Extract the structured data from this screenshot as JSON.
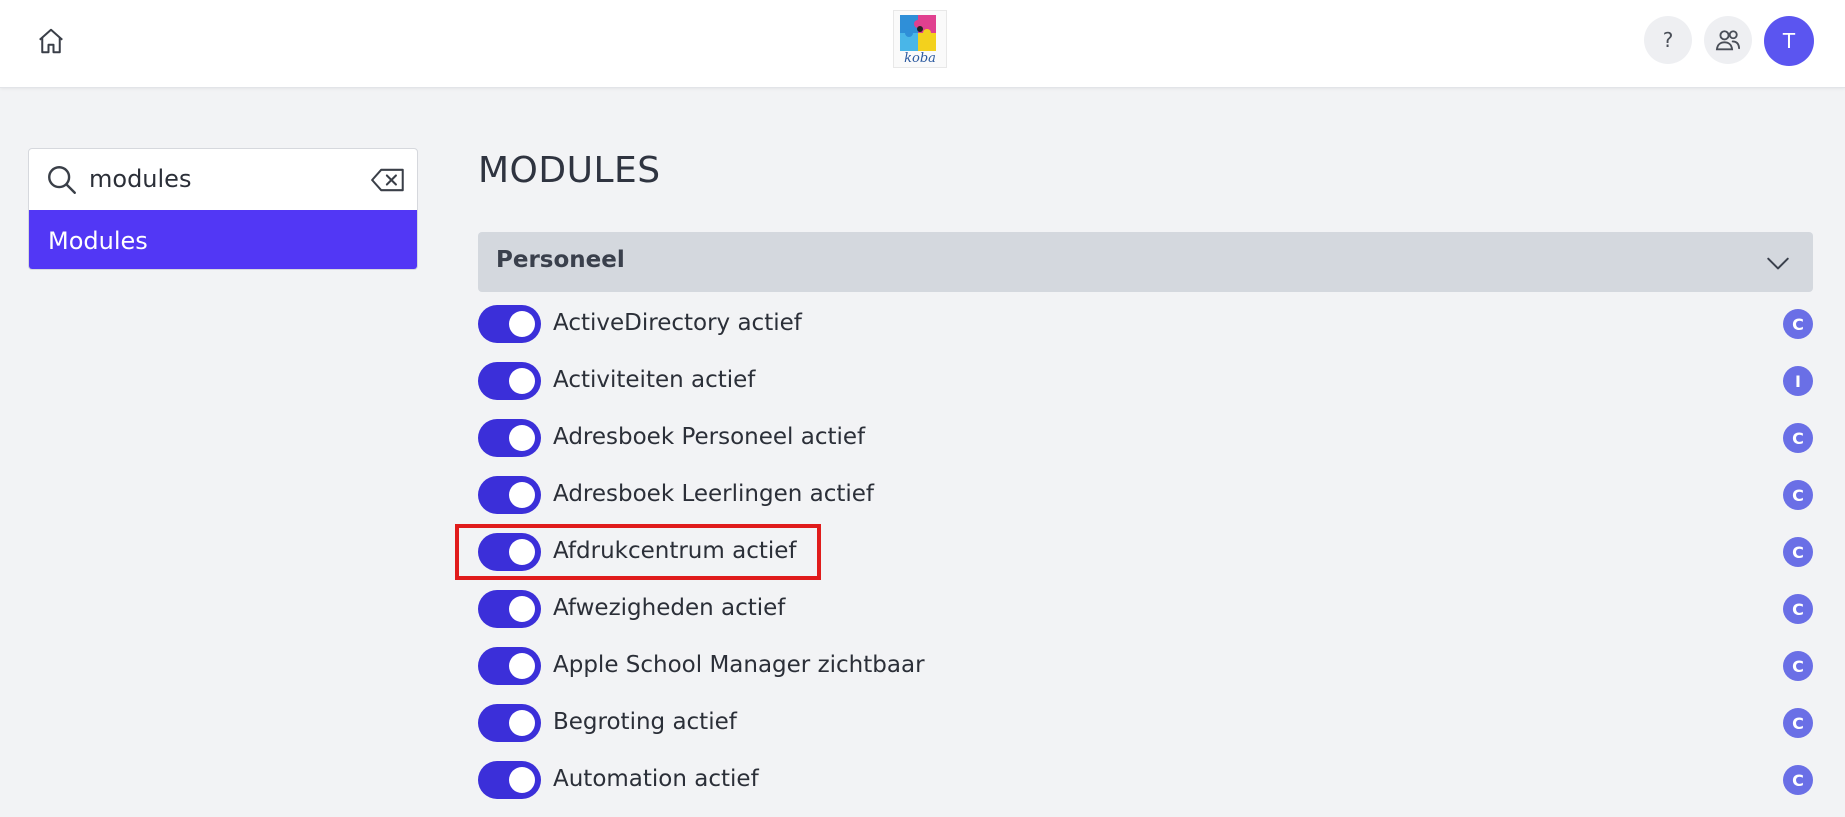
{
  "header": {
    "logo_text": "koba",
    "help_label": "?",
    "avatar_initial": "T"
  },
  "search": {
    "value": "modules",
    "result": "Modules"
  },
  "main": {
    "title": "MODULES",
    "section": {
      "label": "Personeel",
      "items": [
        {
          "label": "ActiveDirectory actief",
          "enabled": true,
          "badge": "C"
        },
        {
          "label": "Activiteiten actief",
          "enabled": true,
          "badge": "I"
        },
        {
          "label": "Adresboek Personeel actief",
          "enabled": true,
          "badge": "C"
        },
        {
          "label": "Adresboek Leerlingen actief",
          "enabled": true,
          "badge": "C"
        },
        {
          "label": "Afdrukcentrum actief",
          "enabled": true,
          "badge": "C"
        },
        {
          "label": "Afwezigheden actief",
          "enabled": true,
          "badge": "C"
        },
        {
          "label": "Apple School Manager zichtbaar",
          "enabled": true,
          "badge": "C"
        },
        {
          "label": "Begroting actief",
          "enabled": true,
          "badge": "C"
        },
        {
          "label": "Automation actief",
          "enabled": true,
          "badge": "C"
        }
      ]
    }
  },
  "colors": {
    "accent": "#5237f5",
    "toggle_on": "#3b2fd9",
    "badge": "#6a6fe6",
    "highlight": "#e01b1b"
  }
}
